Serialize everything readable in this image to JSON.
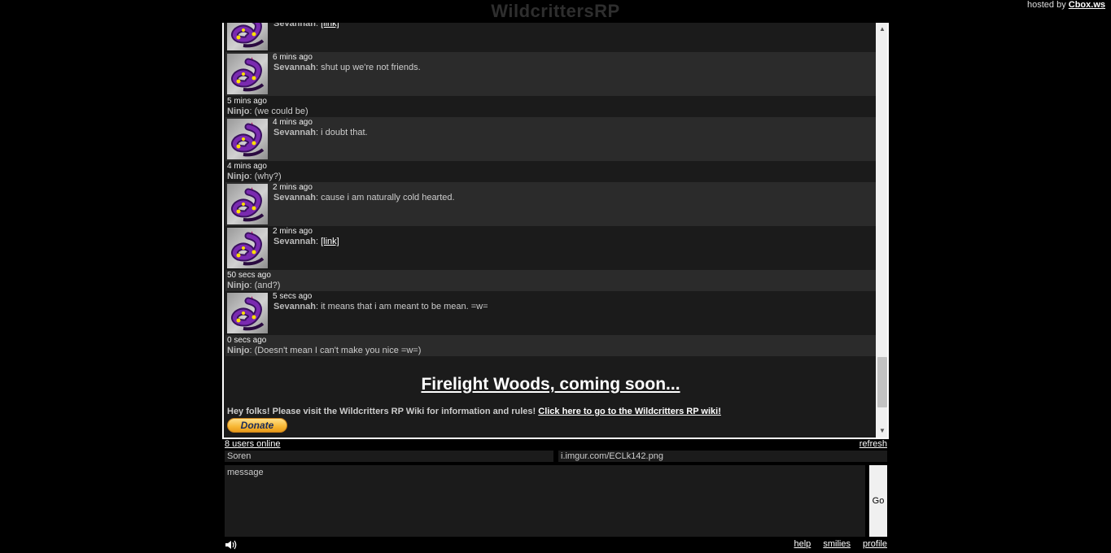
{
  "header": {
    "title": "WildcrittersRP",
    "hosted_prefix": "hosted by",
    "hosted_link": "Cbox.ws"
  },
  "messages": [
    {
      "type": "avatar",
      "shade": "a",
      "time": "",
      "user": "Sevannah",
      "sep": ": ",
      "text": "",
      "link": "[link]"
    },
    {
      "type": "avatar",
      "shade": "b",
      "time": "6 mins ago",
      "user": "Sevannah",
      "sep": ": ",
      "text": "shut up we're not friends.",
      "link": ""
    },
    {
      "type": "text",
      "shade": "a",
      "time": "5 mins ago",
      "user": "Ninjo",
      "sep": ": ",
      "text": "(we could be)",
      "link": ""
    },
    {
      "type": "avatar",
      "shade": "b",
      "time": "4 mins ago",
      "user": "Sevannah",
      "sep": ": ",
      "text": "i doubt that.",
      "link": ""
    },
    {
      "type": "text",
      "shade": "a",
      "time": "4 mins ago",
      "user": "Ninjo",
      "sep": ": ",
      "text": "(why?)",
      "link": ""
    },
    {
      "type": "avatar",
      "shade": "b",
      "time": "2 mins ago",
      "user": "Sevannah",
      "sep": ": ",
      "text": "cause i am naturally cold hearted.",
      "link": ""
    },
    {
      "type": "avatar",
      "shade": "a",
      "time": "2 mins ago",
      "user": "Sevannah",
      "sep": ": ",
      "text": "",
      "link": "[link]"
    },
    {
      "type": "text",
      "shade": "b",
      "time": "50 secs ago",
      "user": "Ninjo",
      "sep": ": ",
      "text": "(and?)",
      "link": ""
    },
    {
      "type": "avatar",
      "shade": "a",
      "time": "5 secs ago",
      "user": "Sevannah",
      "sep": ": ",
      "text": "it means that i am meant to be mean. =w=",
      "link": ""
    },
    {
      "type": "text",
      "shade": "b",
      "time": "0 secs ago",
      "user": "Ninjo",
      "sep": ": ",
      "text": "(Doesn't mean I can't make you nice =w=)",
      "link": ""
    }
  ],
  "banner": {
    "title": "Firelight Woods, coming soon...",
    "text": "Hey folks! Please visit the Wildcritters RP Wiki for information and rules! ",
    "link": "Click here to go to the Wildcritters RP wiki!",
    "donate": "Donate"
  },
  "scroll": {
    "position": 0.95
  },
  "footer": {
    "users_online": "8 users online",
    "refresh": "refresh",
    "name_value": "Soren",
    "url_value": "i.imgur.com/ECLk142.png",
    "message_placeholder": "message",
    "go": "Go",
    "help": "help",
    "smilies": "smilies",
    "profile": "profile"
  },
  "icons": {
    "avatar": "purple-serpent-avatar",
    "sound": "speaker-icon",
    "scroll_up": "triangle-up",
    "scroll_down": "triangle-down"
  }
}
